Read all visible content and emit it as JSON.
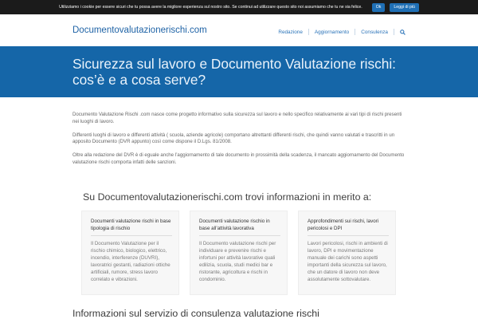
{
  "cookie_bar": {
    "text": "Utilizziamo i cookie per essere sicuri che tu possa avere la migliore esperienza sul nostro sito. Se continui ad utilizzare questo sito noi assumiamo che tu ne sia felice.",
    "ok_label": "Ok",
    "more_label": "Leggi di più"
  },
  "header": {
    "site_title": "Documentovalutazionerischi.com",
    "nav": [
      "Redazione",
      "Aggiornamento",
      "Consulenza"
    ],
    "search_icon": "search-icon"
  },
  "hero": {
    "title": "Sicurezza sul lavoro e Documento Valutazione rischi: cos’è e a cosa serve?"
  },
  "intro": {
    "paragraphs": [
      "Documento Valutazione Rischi .com nasce come progetto informativo sulla sicurezza sul lavoro e nello specifico relativamente ai vari tipi di rischi presenti nei luoghi di lavoro.",
      "Differenti luoghi di lavoro e differenti attività ( scuola, aziende agricole) comportano altrettanti differenti rischi, che quindi vanno valutati e trascritti in un apposito Documento (DVR appunto) così come dispone il D.Lgs. 81/2008.",
      "Oltre alla redazione del DVR è di eguale anche l’aggiornamento di tale documento in prossimità della scadenza, il mancato aggiornamento del Documento valutazione rischi comporta infatti delle sanzioni."
    ]
  },
  "section": {
    "heading": "Su Documentovalutazionerischi.com trovi informazioni in merito a:"
  },
  "cards": [
    {
      "title": "Documenti valutazione rischi in base tipologia di rischio",
      "text": "Il Documento Valutazione per il rischio chimico, biologico, elettrico, incendio, interferenze (DUVRI), lavoratrici gestanti, radiazioni ottiche artificiali, rumore, stress lavoro correlato e vibrazioni."
    },
    {
      "title": "Documenti valutazione rischio in base all’attività lavorativa",
      "text": "Il Documento valutazione rischi per individuare e prevenire rischi e infortuni per attività lavorative quali edilizia, scuola, studi medici  bar e ristorante, agricoltura e rischi in condominio."
    },
    {
      "title": "Approfondimenti sui rischi, lavori pericolosi e DPI",
      "text": "Lavori pericolosi, rischi in ambienti di lavoro, DPI e movimentazione manuale dei carichi sono aspetti importanti della sicurezza sul lavoro, che un datore di lavoro non deve assolutamente sottovalutare."
    }
  ],
  "bottom": {
    "heading": "Informazioni sul servizio di consulenza valutazione rischi"
  },
  "colors": {
    "accent": "#1566a8",
    "link": "#1f63a6",
    "cookie_bar": "#1b1b1b"
  }
}
